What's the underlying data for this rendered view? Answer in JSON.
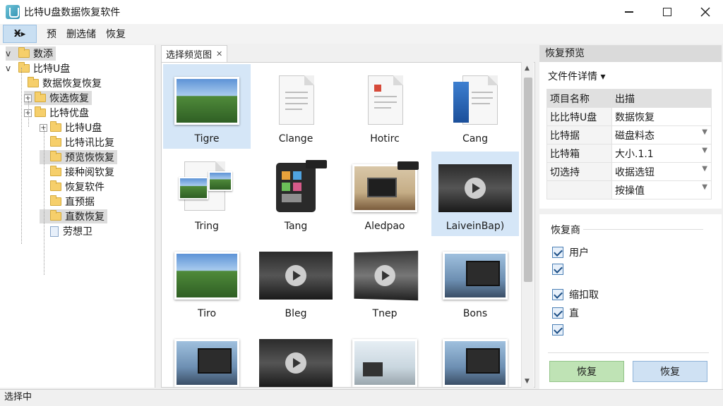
{
  "window": {
    "title": "比特U盘数据恢复软件"
  },
  "menu": {
    "first_label": "Ӿ▸",
    "items": [
      "预",
      "删选储",
      "恢复"
    ]
  },
  "tree": [
    {
      "label": "数添",
      "level": 0,
      "expander": "caret",
      "icon": "folder-icon",
      "selected": true
    },
    {
      "label": "比特U盘",
      "level": 0,
      "expander": "caret",
      "icon": "folder-icon",
      "selected": false
    },
    {
      "label": "数据恢复恢复",
      "level": 1,
      "expander": "none",
      "icon": "folder-icon",
      "selected": false
    },
    {
      "label": "恢选恢复",
      "level": 2,
      "expander": "plus",
      "icon": "folder-icon",
      "selected": true
    },
    {
      "label": "比特优盘",
      "level": 2,
      "expander": "plus",
      "icon": "folder-icon",
      "selected": false
    },
    {
      "label": "比特U盘",
      "level": 3,
      "expander": "plus",
      "icon": "folder-icon",
      "selected": false
    },
    {
      "label": "比特讯比复",
      "level": 3,
      "expander": "none",
      "icon": "folder-icon",
      "selected": false
    },
    {
      "label": "预览恢恢复",
      "level": 3,
      "expander": "none",
      "icon": "folder-icon",
      "selected": true
    },
    {
      "label": "接种阅钦复",
      "level": 3,
      "expander": "none",
      "icon": "folder-icon",
      "selected": false
    },
    {
      "label": "恢复软件",
      "level": 3,
      "expander": "none",
      "icon": "folder-icon",
      "selected": false
    },
    {
      "label": "直预据",
      "level": 3,
      "expander": "none",
      "icon": "folder-icon",
      "selected": false
    },
    {
      "label": "直数恢复",
      "level": 3,
      "expander": "none",
      "icon": "folder-icon",
      "selected": true
    },
    {
      "label": "劳想卫",
      "level": 3,
      "expander": "none",
      "icon": "file-icon",
      "selected": false
    }
  ],
  "tab": {
    "label": "选择频览图"
  },
  "tiles": [
    {
      "label": "Tigre",
      "kind": "landscape",
      "selected": true
    },
    {
      "label": "Clange",
      "kind": "document",
      "selected": false
    },
    {
      "label": "Hotirc",
      "kind": "document-red",
      "selected": false
    },
    {
      "label": "Cang",
      "kind": "document-blue",
      "selected": false
    },
    {
      "label": "Tring",
      "kind": "photo-stack",
      "selected": false
    },
    {
      "label": "Tang",
      "kind": "app-tablet",
      "selected": false
    },
    {
      "label": "Aledpao",
      "kind": "desk-photo",
      "selected": false
    },
    {
      "label": "LaiveinBap)",
      "kind": "video",
      "selected": true
    },
    {
      "label": "Tiro",
      "kind": "landscape",
      "selected": false
    },
    {
      "label": "Bleg",
      "kind": "video",
      "selected": false
    },
    {
      "label": "Tnep",
      "kind": "video-skew",
      "selected": false
    },
    {
      "label": "Bons",
      "kind": "monitor-photo",
      "selected": false
    },
    {
      "label": "",
      "kind": "monitor-photo",
      "selected": false
    },
    {
      "label": "",
      "kind": "video",
      "selected": false
    },
    {
      "label": "",
      "kind": "office-photo",
      "selected": false
    },
    {
      "label": "",
      "kind": "monitor-photo",
      "selected": false
    }
  ],
  "preview": {
    "header": "恢复预览",
    "details_button": "文件件详情 ▾",
    "properties": [
      {
        "key": "项目名称",
        "value": "出描",
        "dropdown": false
      },
      {
        "key": "比比特U盘",
        "value": "数据恢复",
        "dropdown": false
      },
      {
        "key": "比特据",
        "value": "磁盘料态",
        "dropdown": true
      },
      {
        "key": "比特箱",
        "value": "大小.1.1",
        "dropdown": true
      },
      {
        "key": "切选持",
        "value": "收据选钮",
        "dropdown": true
      },
      {
        "key": "",
        "value": "按操值",
        "dropdown": true
      }
    ]
  },
  "options": {
    "title": "恢复商",
    "checkboxes": [
      {
        "label": "用户",
        "checked": true
      },
      {
        "label": "",
        "checked": true
      },
      {
        "label": "缩扣取",
        "checked": true
      },
      {
        "label": "直",
        "checked": true
      },
      {
        "label": "",
        "checked": true
      }
    ],
    "buttons": [
      "恢复",
      "恢复"
    ]
  },
  "status": {
    "text": "选择中"
  }
}
